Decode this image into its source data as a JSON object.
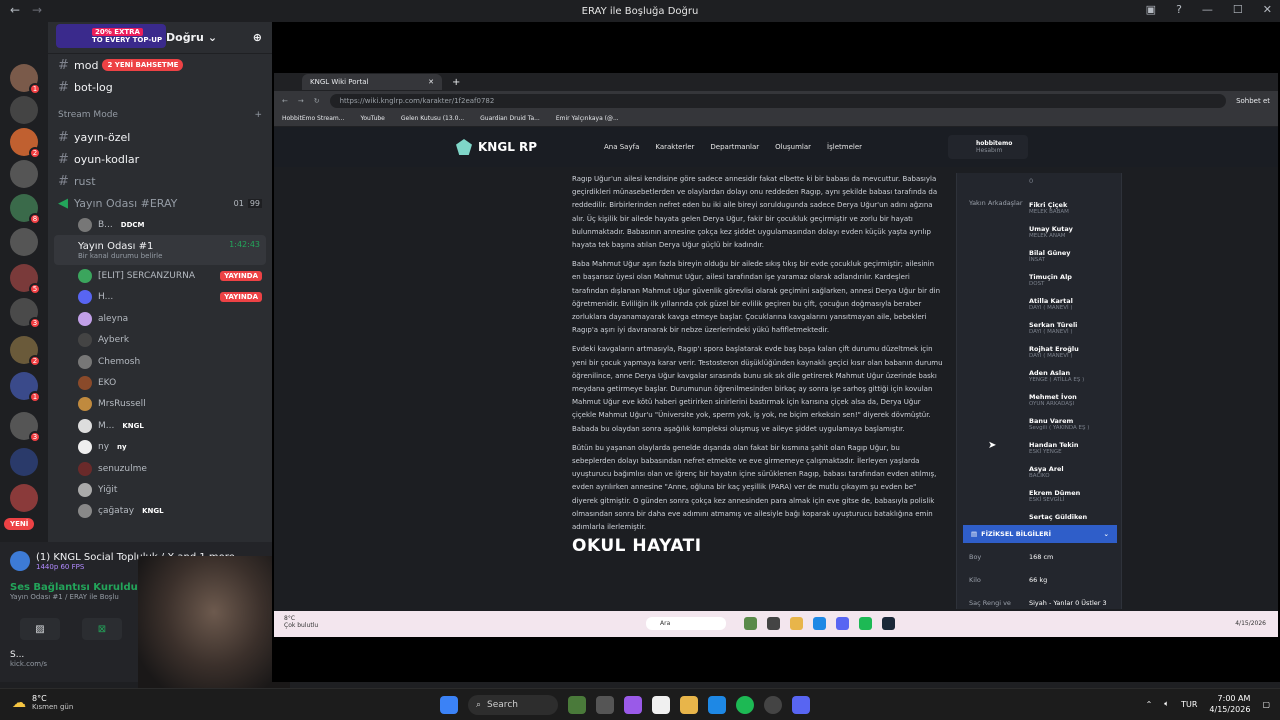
{
  "window": {
    "title": "ERAY ile Boşluğa Doğru"
  },
  "server": {
    "name": "Doğru",
    "promo": {
      "line1": "20% EXTRA",
      "line2": "TO EVERY TOP-UP"
    },
    "channels_top": [
      {
        "name": "mod",
        "badge": "2 YENİ BAHSETME"
      },
      {
        "name": "bot-log",
        "badge": ""
      }
    ],
    "category": "Stream Mode",
    "channels": [
      "yayın-özel",
      "oyun-kodlar",
      "rust"
    ],
    "voice1": {
      "name": "Yayın Odası #ERAY",
      "count_a": "01",
      "count_b": "99"
    },
    "voice1_members": [
      {
        "name": "B...",
        "tag": "DDCM"
      }
    ],
    "voice2": {
      "name": "Yayın Odası #1",
      "status": "Bir kanal durumu belirle",
      "time": "1:42:43"
    },
    "voice2_members": [
      {
        "name": "[ELIT] SERCANZURNA",
        "live": "YAYINDA",
        "color": "#3ba55d"
      },
      {
        "name": "H...",
        "live": "YAYINDA",
        "color": "#5865f2"
      },
      {
        "name": "aleyna",
        "live": "",
        "color": "#c2a0e8"
      },
      {
        "name": "Ayberk",
        "live": "",
        "color": "#444"
      },
      {
        "name": "Chemosh",
        "live": "",
        "color": "#777"
      },
      {
        "name": "EKO",
        "live": "",
        "color": "#8a4a2a"
      },
      {
        "name": "MrsRussell",
        "live": "",
        "color": "#c08a3e"
      },
      {
        "name": "M...",
        "tag": "KNGL",
        "live": "",
        "color": "#ddd"
      },
      {
        "name": "ny",
        "tag": "ny",
        "live": "",
        "color": "#eee"
      },
      {
        "name": "senuzulme",
        "live": "",
        "color": "#6a2a2a"
      },
      {
        "name": "Yiğit",
        "live": "",
        "color": "#aaa"
      },
      {
        "name": "çağatay",
        "tag": "KNGL",
        "live": "",
        "color": "#888"
      }
    ],
    "yeni_label": "YENİ"
  },
  "bottom": {
    "notification": "(1) KNGL Social Topluluk / X and 1 more ...",
    "notification_sub": "1440p 60 FPS",
    "voice_connected": "Ses Bağlantısı Kuruldu",
    "voice_channel": "Yayın Odası #1 / ERAY ile Boşlu",
    "user_name": "S...",
    "user_status": "kick.com/s"
  },
  "browser": {
    "tab_title": "KNGL Wiki Portal",
    "url": "https://wiki.knglrp.com/karakter/1f2eaf0782",
    "bookmarks": [
      "HobbitEmo Stream...",
      "YouTube",
      "Gelen Kutusu (13.0...",
      "Guardian Druid Ta...",
      "Emir Yalçınkaya (@..."
    ],
    "profile_label": "Sohbet et"
  },
  "site": {
    "logo": "KNGL RP",
    "nav": [
      "Ana Sayfa",
      "Karakterler",
      "Departmanlar",
      "Oluşumlar",
      "İşletmeler"
    ],
    "account": {
      "name": "hobbitemo",
      "sub": "Hesabım"
    },
    "paragraphs": [
      "Ragıp Uğur'un ailesi kendisine göre sadece annesidir fakat elbette ki bir babası da mevcuttur. Babasıyla geçirdikleri münasebetlerden ve olaylardan dolayı onu reddeden Ragıp, aynı şekilde babası tarafında da reddedilir. Birbirlerinden nefret eden bu iki aile bireyi soruldugunda sadece Derya Uğur'un adını ağzına alır. Üç kişilik bir ailede hayata gelen Derya Uğur, fakir bir çocukluk geçirmiştir ve zorlu bir hayatı bulunmaktadır. Babasının annesine çokça kez şiddet uygulamasından dolayı evden küçük yaşta ayrılıp hayata tek başına atılan Derya Uğur güçlü bir kadındır.",
      "Baba Mahmut Uğur aşırı fazla bireyin olduğu bir ailede sıkış tıkış bir evde çocukluk geçirmiştir; ailesinin en başarısız üyesi olan Mahmut Uğur, ailesi tarafından işe yaramaz olarak adlandırılır. Kardeşleri tarafından dışlanan Mahmut Uğur güvenlik görevlisi olarak geçimini sağlarken, annesi Derya Uğur bir din öğretmenidir. Evliliğin ilk yıllarında çok güzel bir evlilik geçiren bu çift, çocuğun doğmasıyla beraber zorluklara dayanamayarak kavga etmeye başlar. Çocuklarına kavgalarını yansıtmayan aile, bebekleri Ragıp'a aşırı iyi davranarak bir nebze üzerlerindeki yükü hafifletmektedir.",
      "Evdeki kavgaların artmasıyla, Ragıp'ı spora başlatarak evde baş başa kalan çift durumu düzeltmek için yeni bir çocuk yapmaya karar verir. Testosteron düşüklüğünden kaynaklı geçici kısır olan babanın durumu öğrenilince, anne Derya Uğur kavgalar sırasında bunu sık sık dile getirerek Mahmut Uğur üzerinde baskı meydana getirmeye başlar. Durumunun öğrenilmesinden birkaç ay sonra işe sarhoş gittiği için kovulan Mahmut Uğur eve kötü haberi getirirken sinirlerini bastırmak için karısına çiçek alsa da, Derya Uğur çiçekle Mahmut Uğur'u \"Üniversite yok, sperm yok, iş yok, ne biçim erkeksin sen!\" diyerek dövmüştür. Babada bu olaydan sonra aşağılık kompleksi oluşmuş ve aileye şiddet uygulamaya başlamıştır.",
      "Bütün bu yaşanan olaylarda genelde dışarıda olan fakat bir kısmına şahit olan Ragıp Uğur, bu sebeplerden dolayı babasından nefret etmekte ve eve girmemeye çalışmaktadır. İlerleyen yaşlarda uyuşturucu bağımlısı olan ve iğrenç bir hayatın içine sürüklenen Ragıp, babası tarafından evden atılmış, evden ayrılırken annesine \"Anne, oğluna bir kaç yeşillik (PARA) ver de mutlu çıkayım şu evden be\" diyerek gitmiştir. O günden sonra çokça kez annesinden para almak için eve gitse de, babasıyla polislik olmasından sonra bir daha eve adımını atmamış ve ailesiyle bağı koparak uyuşturucu bataklığına emin adımlarla ilerlemiştir."
    ],
    "section_heading": "OKUL HAYATI",
    "panel_top_value": "0",
    "friends_label": "Yakın Arkadaşlar",
    "friends": [
      {
        "name": "Fikri Çiçek",
        "role": "MELEK BABAM"
      },
      {
        "name": "Umay Kutay",
        "role": "MELEK ANAM"
      },
      {
        "name": "Bilal Güney",
        "role": "İNSAT"
      },
      {
        "name": "Timuçin Alp",
        "role": "DOST"
      },
      {
        "name": "Atilla Kartal",
        "role": "DAYI ( MANEVİ )"
      },
      {
        "name": "Serkan Türeli",
        "role": "DAYI ( MANEVİ )"
      },
      {
        "name": "Rojhat Eroğlu",
        "role": "DAYI ( MANEVİ )"
      },
      {
        "name": "Aden Aslan",
        "role": "YENGE ( ATİLLA EŞ )"
      },
      {
        "name": "Mehmet İvon",
        "role": "OYUN ARKADAŞI"
      },
      {
        "name": "Banu Varem",
        "role": "Sevgili ( YAKINDA EŞ )"
      },
      {
        "name": "Handan Tekin",
        "role": "ESKİ YENGE"
      },
      {
        "name": "Asya Arel",
        "role": "BACIKO"
      },
      {
        "name": "Ekrem Dümen",
        "role": "ESKİ SEVGİLİ"
      },
      {
        "name": "Sertaç Güldiken",
        "role": ""
      }
    ],
    "physical_title": "FİZİKSEL BİLGİLERİ",
    "physical": [
      {
        "label": "Boy",
        "value": "168 cm"
      },
      {
        "label": "Kilo",
        "value": "66 kg"
      },
      {
        "label": "Saç Rengi ve",
        "value": "Siyah - Yanlar 0 Üstler 3"
      }
    ],
    "inner_weather": {
      "temp": "8°C",
      "desc": "Çok bulutlu"
    },
    "inner_search": "Ara",
    "inner_time": "4/15/2026"
  },
  "taskbar": {
    "weather_temp": "8°C",
    "weather_desc": "Kısmen gün",
    "search": "Search",
    "lang": "TUR",
    "time": "7:00 AM",
    "date": "4/15/2026"
  },
  "colors": {
    "discord_bg": "#2b2d31",
    "live_red": "#ed4245",
    "accent_blue": "#2f5ec9",
    "voice_green": "#23a55a"
  }
}
